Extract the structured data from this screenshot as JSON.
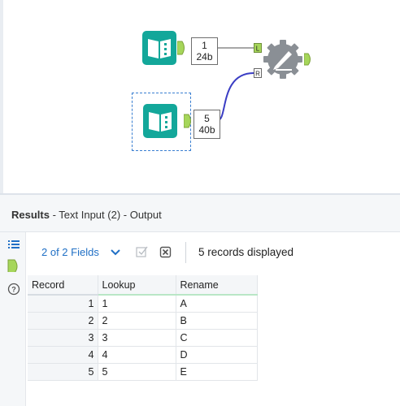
{
  "canvas": {
    "top_tool": {
      "name": "text-input-tool",
      "count": "1",
      "size": "24b"
    },
    "bottom_tool": {
      "name": "text-input-tool-2",
      "count": "5",
      "size": "40b"
    },
    "join_tool": {
      "name": "dynamic-rename-tool",
      "left_anchor": "L",
      "right_anchor": "R"
    },
    "colors": {
      "accent": "#13a79a",
      "anchor": "#a6d65a",
      "connection_selected": "#3a3dc4",
      "connection": "#8a8a8a",
      "gear": "#8a8f95"
    }
  },
  "results": {
    "title_bold": "Results",
    "title_rest": " - Text Input (2) - Output",
    "fields_label": "2 of 2 Fields",
    "records_label": "5 records displayed",
    "columns": [
      "Record",
      "Lookup",
      "Rename"
    ],
    "rows": [
      {
        "record": "1",
        "lookup": "1",
        "rename": "A"
      },
      {
        "record": "2",
        "lookup": "2",
        "rename": "B"
      },
      {
        "record": "3",
        "lookup": "3",
        "rename": "C"
      },
      {
        "record": "4",
        "lookup": "4",
        "rename": "D"
      },
      {
        "record": "5",
        "lookup": "5",
        "rename": "E"
      }
    ]
  }
}
